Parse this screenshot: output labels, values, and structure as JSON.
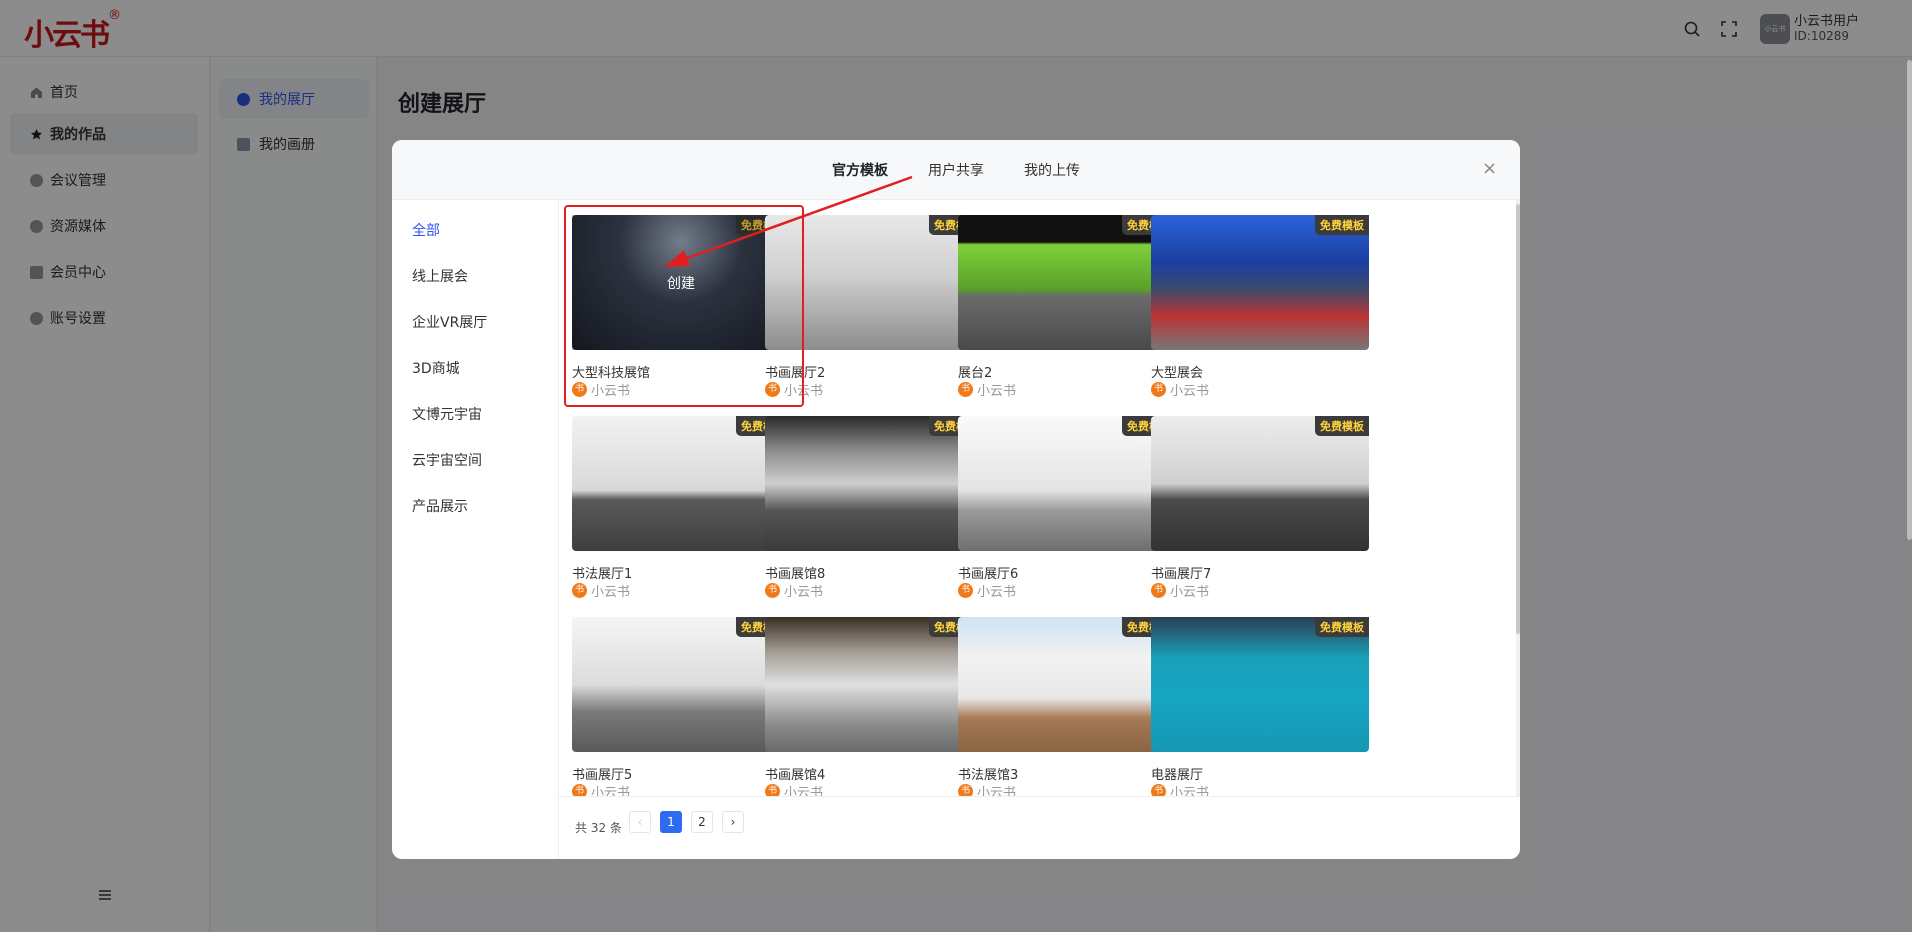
{
  "app": {
    "logo_text": "小云书",
    "logo_mark": "®"
  },
  "header": {
    "avatar_text": "小云书",
    "user_name": "小云书用户",
    "user_id": "ID:10289"
  },
  "sidebar": {
    "items": [
      {
        "label": "首页",
        "icon": "home-icon"
      },
      {
        "label": "我的作品",
        "icon": "star-icon"
      },
      {
        "label": "会议管理",
        "icon": "meeting-icon"
      },
      {
        "label": "资源媒体",
        "icon": "media-icon"
      },
      {
        "label": "会员中心",
        "icon": "member-icon"
      },
      {
        "label": "账号设置",
        "icon": "settings-icon"
      }
    ]
  },
  "subnav": {
    "items": [
      {
        "label": "我的展厅"
      },
      {
        "label": "我的画册"
      }
    ]
  },
  "page": {
    "title": "创建展厅"
  },
  "modal": {
    "tabs": [
      {
        "label": "官方模板"
      },
      {
        "label": "用户共享"
      },
      {
        "label": "我的上传"
      }
    ],
    "close": "×",
    "categories": [
      {
        "label": "全部"
      },
      {
        "label": "线上展会"
      },
      {
        "label": "企业VR展厅"
      },
      {
        "label": "3D商城"
      },
      {
        "label": "文博元宇宙"
      },
      {
        "label": "云宇宙空间"
      },
      {
        "label": "产品展示"
      }
    ],
    "badge": "免费模板",
    "create_label": "创建",
    "author_icon": "书",
    "cards": [
      {
        "title": "大型科技展馆",
        "author": "小云书"
      },
      {
        "title": "书画展厅2",
        "author": "小云书"
      },
      {
        "title": "展台2",
        "author": "小云书"
      },
      {
        "title": "大型展会",
        "author": "小云书"
      },
      {
        "title": "书法展厅1",
        "author": "小云书"
      },
      {
        "title": "书画展馆8",
        "author": "小云书"
      },
      {
        "title": "书画展厅6",
        "author": "小云书"
      },
      {
        "title": "书画展厅7",
        "author": "小云书"
      },
      {
        "title": "书画展厅5",
        "author": "小云书"
      },
      {
        "title": "书画展馆4",
        "author": "小云书"
      },
      {
        "title": "书法展馆3",
        "author": "小云书"
      },
      {
        "title": "电器展厅",
        "author": "小云书"
      }
    ],
    "pagination": {
      "total": "共 32 条",
      "prev": "‹",
      "next": "›",
      "pages": [
        "1",
        "2"
      ],
      "current": "1"
    }
  },
  "colors": {
    "accent": "#2f54eb",
    "brand": "#c8161d",
    "badge_text": "#ffd23a",
    "highlight": "#e02020"
  }
}
